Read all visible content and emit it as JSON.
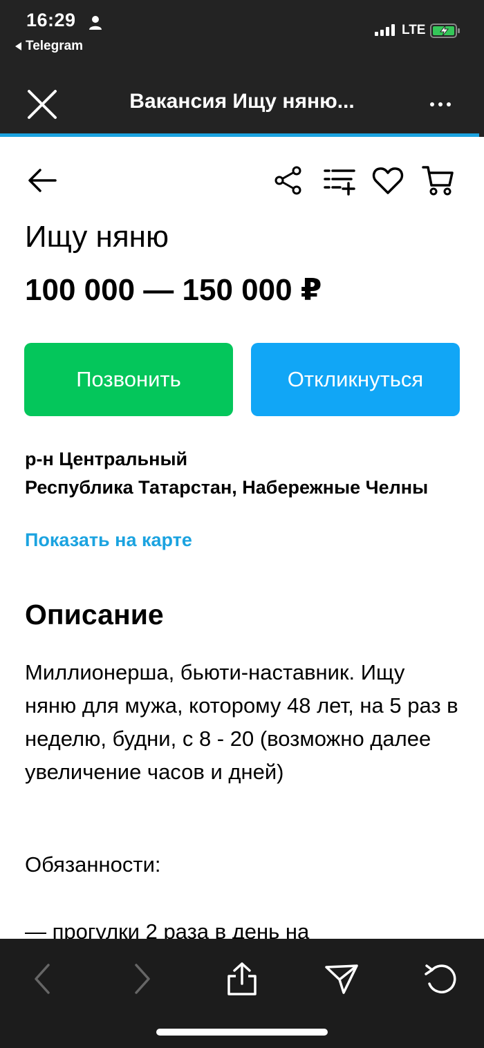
{
  "status_bar": {
    "time": "16:29",
    "back_app": "Telegram",
    "network": "LTE"
  },
  "browser_header": {
    "title": "Вакансия Ищу няню..."
  },
  "listing": {
    "title": "Ищу няню",
    "salary": "100 000 — 150 000 ₽",
    "call_button": "Позвонить",
    "apply_button": "Откликнуться",
    "district": "р-н Центральный",
    "address_line": "Республика Татарстан, Набережные Челны",
    "map_link": "Показать на карте",
    "description_heading": "Описание",
    "description": "Миллионерша, бьюти-наставник. Ищу няню для мужа, которому 48 лет, на 5 раз в неделю, будни, с 8 - 20 (возможно далее увеличение часов и дней)",
    "duties_label": "Обязанности:",
    "duty_partial": "— прогулки 2 раза в день на"
  },
  "icons": {
    "close": "close-icon",
    "more": "more-icon",
    "back": "arrow-left-icon",
    "share": "share-icon",
    "list_add": "list-add-icon",
    "favorite": "heart-icon",
    "cart": "cart-icon",
    "nav_back": "chevron-left-icon",
    "nav_forward": "chevron-right-icon",
    "share_sheet": "share-upload-icon",
    "send": "send-icon",
    "reload": "reload-icon"
  },
  "colors": {
    "call_button": "#04c65b",
    "apply_button": "#11a6f6",
    "link": "#1ba3e0",
    "header_bg": "#232323",
    "toolbar_bg": "#1c1c1c"
  }
}
